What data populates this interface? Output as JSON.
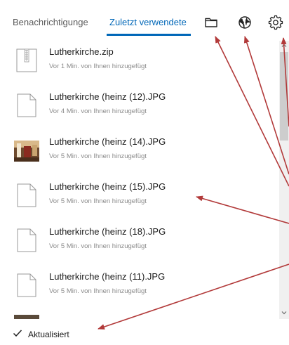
{
  "tabs": {
    "notifications_label": "Benachrichtigunge",
    "recent_label": "Zuletzt verwendete"
  },
  "header_icons": [
    "folder-icon",
    "globe-icon",
    "gear-icon"
  ],
  "files": [
    {
      "name": "Lutherkirche.zip",
      "meta": "Vor 1 Min. von Ihnen hinzugefügt",
      "icon": "zip-icon"
    },
    {
      "name": "Lutherkirche (heinz (12).JPG",
      "meta": "Vor 4 Min. von Ihnen hinzugefügt",
      "icon": "file-icon"
    },
    {
      "name": "Lutherkirche (heinz (14).JPG",
      "meta": "Vor 5 Min. von Ihnen hinzugefügt",
      "icon": "image-thumbnail"
    },
    {
      "name": "Lutherkirche (heinz (15).JPG",
      "meta": "Vor 5 Min. von Ihnen hinzugefügt",
      "icon": "file-icon"
    },
    {
      "name": "Lutherkirche (heinz (18).JPG",
      "meta": "Vor 5 Min. von Ihnen hinzugefügt",
      "icon": "file-icon"
    },
    {
      "name": "Lutherkirche (heinz (11).JPG",
      "meta": "Vor 5 Min. von Ihnen hinzugefügt",
      "icon": "file-icon"
    }
  ],
  "status": {
    "label": "Aktualisiert",
    "icon": "checkmark-icon"
  },
  "colors": {
    "accent": "#0067b8",
    "annotation_arrow": "#b23a3a"
  }
}
